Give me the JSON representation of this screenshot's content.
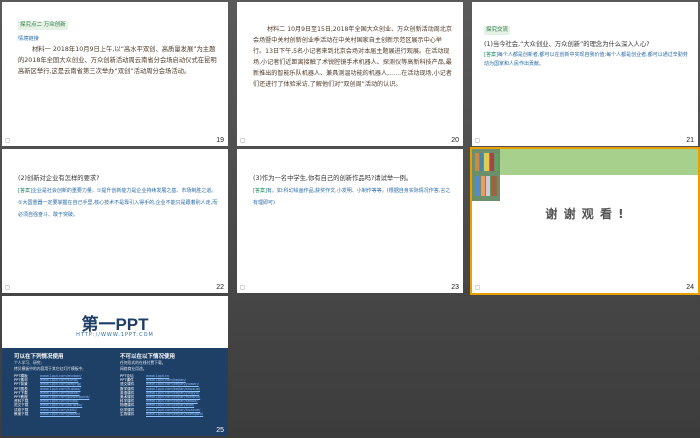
{
  "slides": {
    "s19": {
      "number": "19",
      "tag": "探究点二  万众创新",
      "subtag": "情境链接",
      "body": "材料一  2018年10月9日上午,以“高水平双创、高质量发展”为主题的2018年全国大众创业、万众创新活动周云南省分会场启动仪式在昆明高新区举行,这是云南省第三次举办“双创”活动周分会场活动。"
    },
    "s20": {
      "number": "20",
      "body": "材料二  10月9日至15日,2018年全国大众创业、万众创新活动周北京会场暨中关村创新创业季活动在中关村国家自主创新示范区展示中心举行。13日下午,5名小记者来到北京会场对本届主题展进行观展。在活动现场,小记者们近距离接触了术锐腔镜手术机器人、探测仪等高新科技产品,最新推出的智能乐队机器人、兼具测温功能的机器人,……在活动现场,小记者们还进行了体验采访,了解他们对“双创周”活动的认识。"
    },
    "s21": {
      "number": "21",
      "tag": "探究交流",
      "question": "(1)当今社会,“大众创业、万众创新”的理念为什么深入人心?",
      "answer_label": "[答案]",
      "answer": "每个人都是创新者,都可以在创新中实现自我价值;每个人都是创业者,都可以通过辛勤劳动为国家和人民作出贡献。"
    },
    "s22": {
      "number": "22",
      "question": "(2)创新对企业有怎样的要求?",
      "answer_label": "[答案]",
      "answer": "企业是社会创新的重要力量。①提升创新能力是企业持续发展之基、市场制胜之道。②大国重器一定要掌握在自己手里,核心技术不是靠引入得手的,企业不能只是跟着别人走,而必须自强奋斗、敢于突破。"
    },
    "s23": {
      "number": "23",
      "question": "(3)作为一名中学生,你有自己的创新作品吗?请试举一例。",
      "answer_label": "[答案]",
      "answer": "有。如:科幻绘画作品,获奖作文,小发明、小制作等等。(根据自身实际情况作答,言之有理即可)"
    },
    "s24": {
      "number": "24",
      "thanks": "谢 谢 观 看 !"
    },
    "s25": {
      "number": "25",
      "logo": "第一PPT",
      "url": "HTTP://WWW.1PPT.COM",
      "col1_title": "可以在下列情况使用",
      "col1_sub1": "个人学习、研究;",
      "col1_sub2": "拷贝模板中的内容用于其它幻灯片模板中;",
      "col2_title": "不可以在以下情况使用",
      "col2_sub1": "任何形式的在线付费下载。",
      "col2_sub2": "网络商业用途。",
      "col1_rows": [
        {
          "k": "PPT模板",
          "v": "www.1ppt.com/moban/"
        },
        {
          "k": "PPT素材",
          "v": "www.1ppt.com/sucai/"
        },
        {
          "k": "PPT背景",
          "v": "www.1ppt.com/beijing/"
        },
        {
          "k": "PPT图表",
          "v": "www.1ppt.com/tubiao/"
        },
        {
          "k": "PPT下载",
          "v": "www.1ppt.com/xiazai/"
        },
        {
          "k": "PPT教程",
          "v": "www.1ppt.com/powerpoint/"
        },
        {
          "k": "资料下载",
          "v": "www.1ppt.com/ziliao/"
        },
        {
          "k": "范文下载",
          "v": "www.1ppt.com/fanwen/"
        },
        {
          "k": "试卷下载",
          "v": "www.1ppt.com/shiti/"
        },
        {
          "k": "教案下载",
          "v": "www.1ppt.com/jiaoan/"
        }
      ],
      "col2_rows": [
        {
          "k": "PPT论坛",
          "v": "www.1ppt.cn"
        },
        {
          "k": "PPT课件",
          "v": "www.1ppt.com/kejian/"
        },
        {
          "k": "语文课件",
          "v": "www.1ppt.com/kejian/yuwen/"
        },
        {
          "k": "数学课件",
          "v": "www.1ppt.com/kejian/shuxue/"
        },
        {
          "k": "英语课件",
          "v": "www.1ppt.com/kejian/yingyu/"
        },
        {
          "k": "美术课件",
          "v": "www.1ppt.com/kejian/meishu/"
        },
        {
          "k": "科学课件",
          "v": "www.1ppt.com/kejian/kexue/"
        },
        {
          "k": "物理课件",
          "v": "www.1ppt.com/kejian/wuli/"
        },
        {
          "k": "化学课件",
          "v": "www.1ppt.com/kejian/huaxue/"
        },
        {
          "k": "生物课件",
          "v": "www.1ppt.com/kejian/shengwu/"
        }
      ]
    }
  },
  "comment_glyph": "◻",
  "colors": {
    "background": "#4a4a4a",
    "selected_outline": "#e8a000",
    "accent_green": "#a8d08d",
    "answer_blue": "#2a6aa8",
    "logo_blue": "#1e3f66"
  }
}
